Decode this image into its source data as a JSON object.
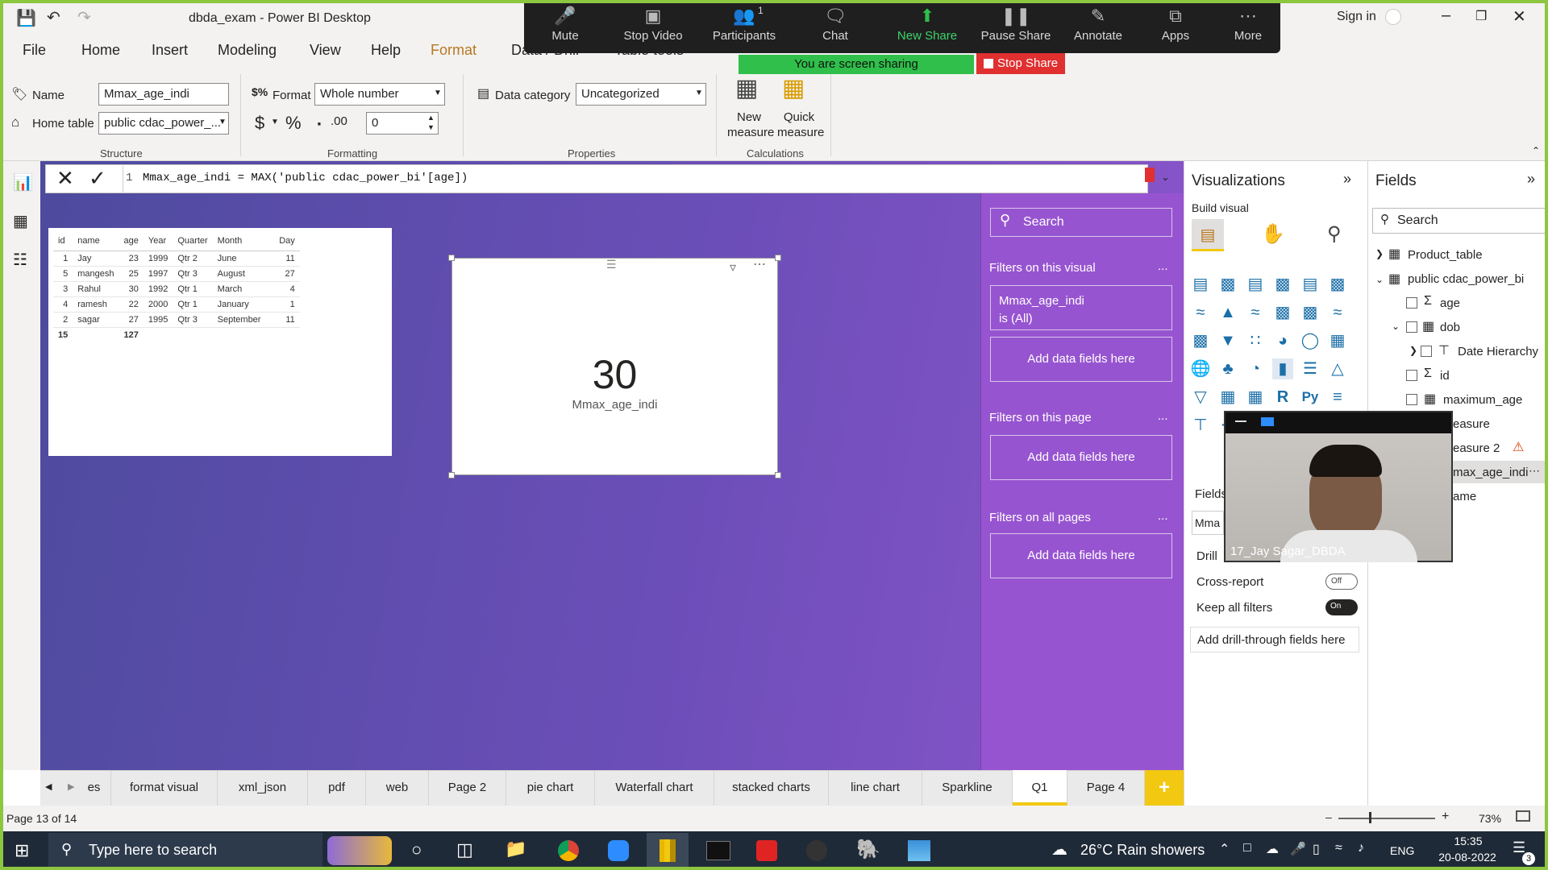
{
  "window": {
    "title": "dbda_exam - Power BI Desktop",
    "signin": "Sign in"
  },
  "menu": [
    "File",
    "Home",
    "Insert",
    "Modeling",
    "View",
    "Help",
    "Format",
    "Data / Drill",
    "Table tools"
  ],
  "ribbon": {
    "name_label": "Name",
    "name_value": "Mmax_age_indi",
    "home_table_label": "Home table",
    "home_table_value": "public cdac_power_...",
    "format_label": "Format",
    "format_value": "Whole number",
    "currency_symbol": "$",
    "percent_symbol": "%",
    "comma_symbol": "̓",
    "decimals_value": "0",
    "data_category_label": "Data category",
    "data_category_value": "Uncategorized",
    "new_measure": "New measure",
    "quick_measure": "Quick measure",
    "groups": {
      "structure": "Structure",
      "formatting": "Formatting",
      "properties": "Properties",
      "calculations": "Calculations"
    }
  },
  "zoom": {
    "items": [
      "Mute",
      "Stop Video",
      "Participants",
      "Chat",
      "New Share",
      "Pause Share",
      "Annotate",
      "Apps",
      "More"
    ],
    "participants_count": "1",
    "banner": "You are screen sharing",
    "stop_share": "Stop Share",
    "webcam_name": "17_Jay Sagar_DBDA"
  },
  "formula": {
    "line": "1",
    "text": "Mmax_age_indi = MAX('public cdac_power_bi'[age])"
  },
  "table_visual": {
    "headers": [
      "id",
      "name",
      "age",
      "Year",
      "Quarter",
      "Month",
      "Day"
    ],
    "rows": [
      [
        "1",
        "Jay",
        "23",
        "1999",
        "Qtr 2",
        "June",
        "11"
      ],
      [
        "5",
        "mangesh",
        "25",
        "1997",
        "Qtr 3",
        "August",
        "27"
      ],
      [
        "3",
        "Rahul",
        "30",
        "1992",
        "Qtr 1",
        "March",
        "4"
      ],
      [
        "4",
        "ramesh",
        "22",
        "2000",
        "Qtr 1",
        "January",
        "1"
      ],
      [
        "2",
        "sagar",
        "27",
        "1995",
        "Qtr 3",
        "September",
        "11"
      ]
    ],
    "total_id": "15",
    "total_age": "127"
  },
  "card": {
    "value": "30",
    "label": "Mmax_age_indi"
  },
  "filters": {
    "search": "Search",
    "on_visual": "Filters on this visual",
    "visual_filter_name": "Mmax_age_indi",
    "visual_filter_state": "is (All)",
    "add_fields": "Add data fields here",
    "on_page": "Filters on this page",
    "on_all": "Filters on all pages",
    "more": "..."
  },
  "viz": {
    "title": "Visualizations",
    "build": "Build visual",
    "fields_label": "Fields",
    "fields_value": "Mma",
    "drill_label": "Drill",
    "cross_report": "Cross-report",
    "cross_report_state": "Off",
    "keep_all": "Keep all filters",
    "keep_all_state": "On",
    "add_drill": "Add drill-through fields here"
  },
  "fields": {
    "title": "Fields",
    "search": "Search",
    "tables": [
      "Product_table",
      "public cdac_power_bi"
    ],
    "items": [
      "age",
      "dob",
      "Date Hierarchy",
      "id",
      "maximum_age",
      "easure",
      "easure 2",
      "max_age_indi",
      "ame"
    ]
  },
  "tabs": [
    "es",
    "format visual",
    "xml_json",
    "pdf",
    "web",
    "Page 2",
    "pie chart",
    "Waterfall chart",
    "stacked charts",
    "line chart",
    "Sparkline",
    "Q1",
    "Page 4"
  ],
  "status": {
    "page": "Page 13 of 14",
    "zoom": "73%"
  },
  "taskbar": {
    "search": "Type here to search",
    "weather": "26°C  Rain showers",
    "lang": "ENG",
    "time": "15:35",
    "date": "20-08-2022",
    "notif": "3"
  }
}
